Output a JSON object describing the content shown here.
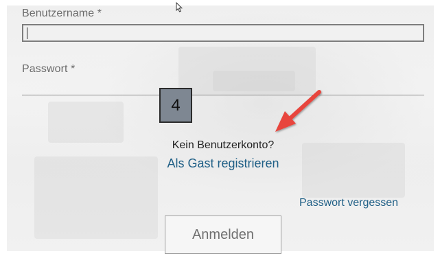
{
  "form": {
    "username_label": "Benutzername *",
    "username_value": "",
    "password_label": "Passwort *",
    "password_value": ""
  },
  "annotation": {
    "step_number": "4",
    "arrow_color": "#e8453c"
  },
  "signup": {
    "prompt": "Kein Benutzerkonto?",
    "guest_link": "Als Gast registrieren"
  },
  "forgot_password": "Passwort vergessen",
  "login_button": "Anmelden",
  "colors": {
    "link": "#1f5f86",
    "badge_bg": "#7e8792"
  },
  "icons": {
    "cursor": "mouse-pointer-icon",
    "arrow": "red-arrow-annotation-icon"
  }
}
